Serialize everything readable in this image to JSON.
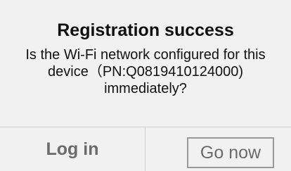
{
  "dialog": {
    "title": "Registration success",
    "message_lines": [
      "Is the Wi-Fi network configured for this",
      "device（PN:Q0819410124000)",
      "immediately?"
    ],
    "buttons": {
      "login_label": "Log in",
      "go_now_label": "Go now"
    }
  }
}
